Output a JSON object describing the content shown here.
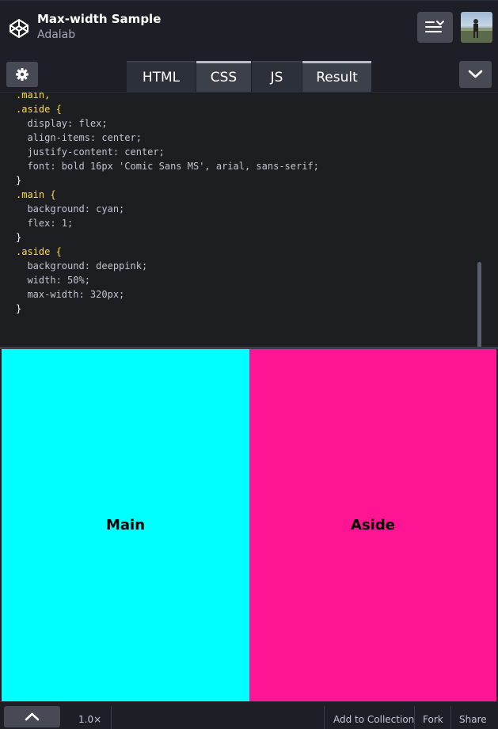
{
  "header": {
    "title": "Max-width Sample",
    "author": "Adalab",
    "logo_icon": "codepen-logo-icon",
    "layout_icon": "layout-icon",
    "avatar_icon": "user-avatar"
  },
  "tabs": [
    {
      "label": "HTML",
      "active": false
    },
    {
      "label": "CSS",
      "active": true
    },
    {
      "label": "JS",
      "active": false
    },
    {
      "label": "Result",
      "active": false
    }
  ],
  "toolbar": {
    "settings_icon": "gear-icon",
    "collapse_icon": "chevron-down-icon"
  },
  "editor": {
    "lines": [
      ".main,",
      ".aside {",
      "  display: flex;",
      "  align-items: center;",
      "  justify-content: center;",
      "  font: bold 16px 'Comic Sans MS', arial, sans-serif;",
      "}",
      ".main {",
      "  background: cyan;",
      "  flex: 1;",
      "}",
      ".aside {",
      "  background: deeppink;",
      "  width: 50%;",
      "  max-width: 320px;",
      "}"
    ]
  },
  "result": {
    "main_label": "Main",
    "aside_label": "Aside",
    "main_color": "#00ffff",
    "aside_color": "#ff1493"
  },
  "footer": {
    "expand_icon": "chevron-up-icon",
    "zoom": "1.0×",
    "add_to_collection": "Add to Collection",
    "fork": "Fork",
    "share": "Share"
  }
}
